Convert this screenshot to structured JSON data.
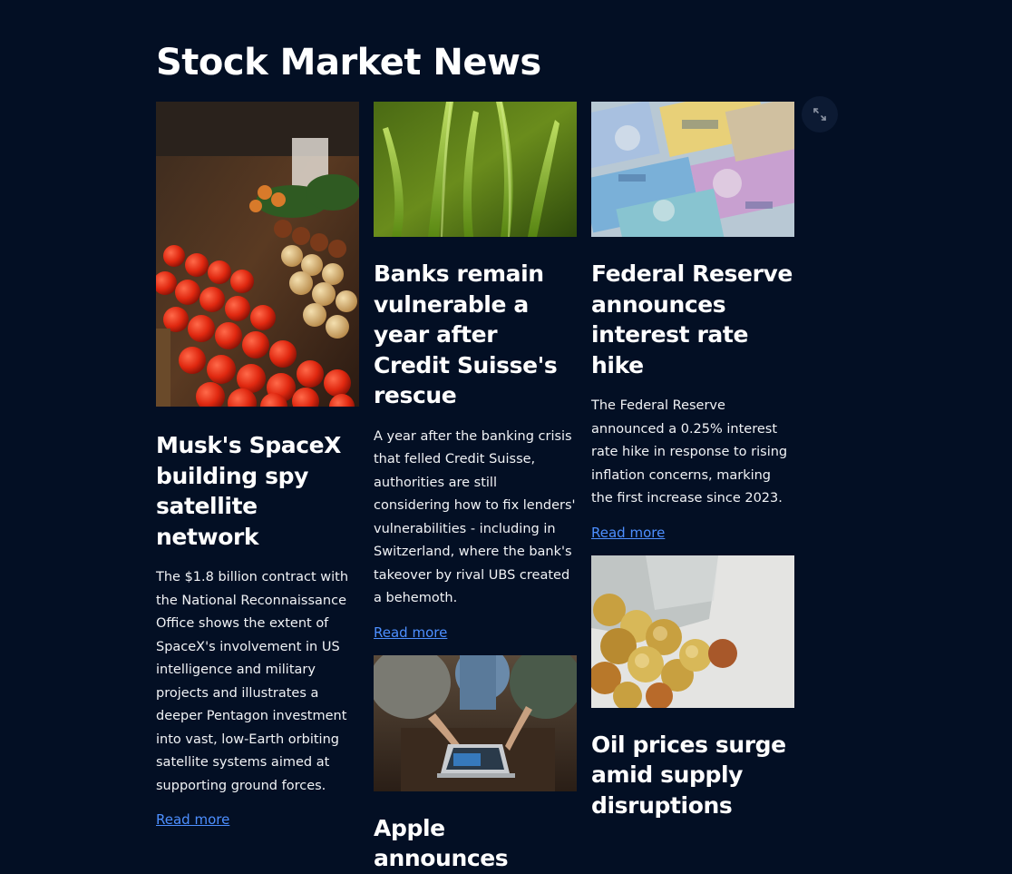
{
  "page": {
    "title": "Stock Market News"
  },
  "articles": [
    {
      "title": "Musk's SpaceX building spy satellite network",
      "description": "The $1.8 billion contract with the National Reconnaissance Office shows the extent of SpaceX's involvement in US intelligence and military projects and illustrates a deeper Pentagon investment into vast, low-Earth orbiting satellite systems aimed at supporting ground forces.",
      "link_text": "Read more",
      "image": "market-vegetables-photo"
    },
    {
      "title": "Banks remain vulnerable a year after Credit Suisse's rescue",
      "description": "A year after the banking crisis that felled Credit Suisse, authorities are still considering how to fix lenders' vulnerabilities - including in Switzerland, where the bank's takeover by rival UBS created a behemoth.",
      "link_text": "Read more",
      "image": "green-grass-photo"
    },
    {
      "title": "Federal Reserve announces interest rate hike",
      "description": "The Federal Reserve announced a 0.25% interest rate hike in response to rising inflation concerns, marking the first increase since 2023.",
      "link_text": "Read more",
      "image": "euro-banknotes-photo"
    },
    {
      "title": "Apple announces",
      "image": "people-with-laptop-photo"
    },
    {
      "title": "Oil prices surge amid supply disruptions",
      "image": "coins-from-jar-photo"
    }
  ],
  "colors": {
    "background": "#030f24",
    "link": "#4d8fff",
    "text": "#ffffff"
  },
  "icons": {
    "fullscreen": "expand-icon"
  }
}
